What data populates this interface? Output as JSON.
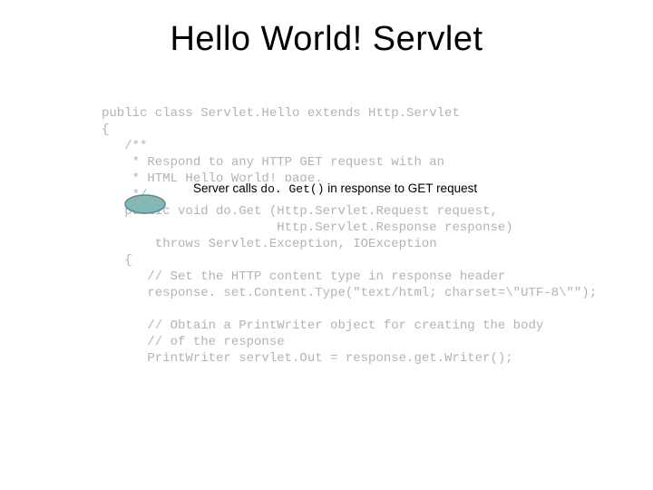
{
  "title": "Hello World! Servlet",
  "code": {
    "line1": "public class Servlet.Hello extends Http.Servlet",
    "line2": "{",
    "line3": "   /**",
    "line4": "    * Respond to any HTTP GET request with an",
    "line5": "    * HTML Hello World! page.",
    "line6": "    */",
    "line7": "   public void do.Get (Http.Servlet.Request request,",
    "line8": "                       Http.Servlet.Response response)",
    "line9": "       throws Servlet.Exception, IOException",
    "line10": "   {",
    "line11": "      // Set the HTTP content type in response header",
    "line12": "      response. set.Content.Type(\"text/html; charset=\\\"UTF-8\\\"\");",
    "line13": "",
    "line14": "      // Obtain a PrintWriter object for creating the body",
    "line15": "      // of the response",
    "line16": "      PrintWriter servlet.Out = response.get.Writer();"
  },
  "annotation": {
    "before": "Server calls ",
    "mono": "do. Get()",
    "after": " in response to GET request"
  },
  "callout": {
    "fill": "#86b6b6",
    "stroke": "#5a8a8a"
  }
}
